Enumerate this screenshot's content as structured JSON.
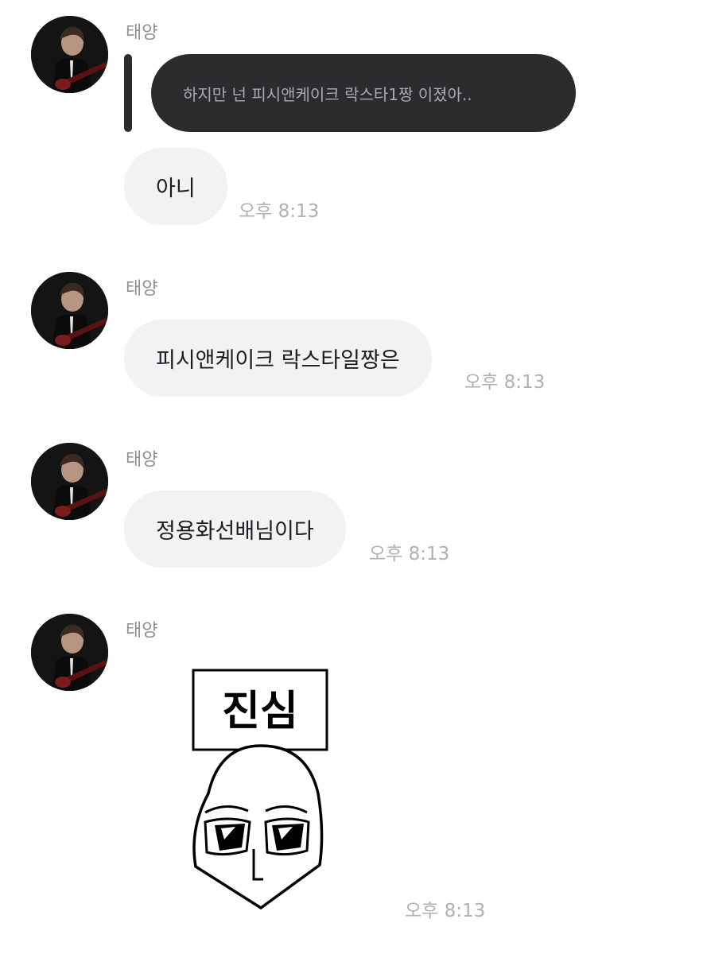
{
  "sender_name": "태양",
  "messages": [
    {
      "reply_text": "하지만 넌 피시앤케이크 락스타1짱 이졌아..",
      "text": "아니",
      "time": "오후 8:13"
    },
    {
      "text": "피시앤케이크 락스타일짱은",
      "time": "오후 8:13"
    },
    {
      "text": "정용화선배님이다",
      "time": "오후 8:13"
    },
    {
      "sticker_text": "진심",
      "time": "오후 8:13"
    }
  ],
  "colors": {
    "dark_bubble": "#2c2c2e",
    "light_bubble": "#f2f2f5",
    "timestamp": "#b0b0b5",
    "sender": "#8e8e93"
  },
  "icons": {
    "sticker": "sincere-face-sticker",
    "avatar": "profile-photo"
  }
}
